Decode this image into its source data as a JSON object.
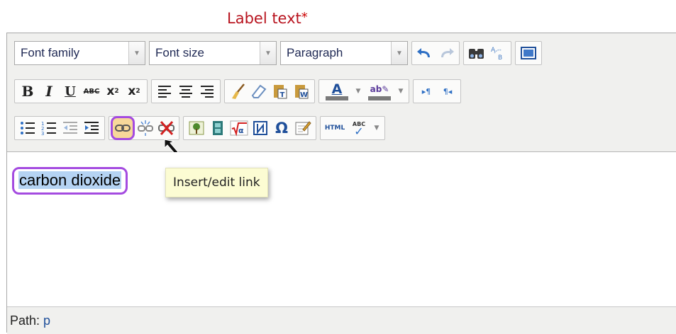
{
  "field_label": "Label text",
  "required_marker": "*",
  "toolbar": {
    "font_family": "Font family",
    "font_size": "Font size",
    "block_format": "Paragraph",
    "html_label": "HTML",
    "spell_label": "ABC"
  },
  "editor": {
    "selected_text": "carbon dioxide",
    "tooltip": "Insert/edit link"
  },
  "status": {
    "path_label": "Path:",
    "path_value": "p"
  },
  "colors": {
    "highlight_border": "#a44be0",
    "label_color": "#b8141f",
    "selection": "#b5d3f3"
  }
}
